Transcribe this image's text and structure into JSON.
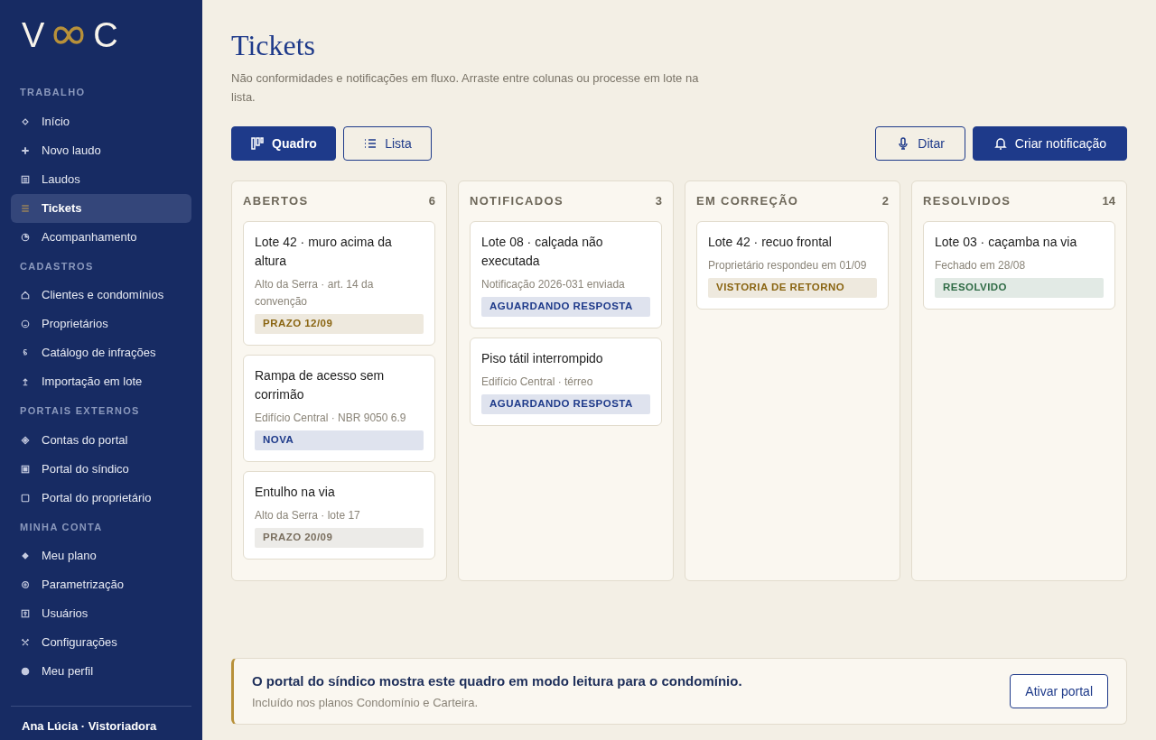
{
  "sidebar": {
    "logo": {
      "left": "V",
      "right": "C"
    },
    "sections": [
      {
        "title": "TRABALHO",
        "items": [
          {
            "label": "Início",
            "selected": false
          },
          {
            "label": "Novo laudo",
            "selected": false
          },
          {
            "label": "Laudos",
            "selected": false
          },
          {
            "label": "Tickets",
            "selected": true
          },
          {
            "label": "Acompanhamento",
            "selected": false
          }
        ]
      },
      {
        "title": "CADASTROS",
        "items": [
          {
            "label": "Clientes e condomínios",
            "selected": false
          },
          {
            "label": "Proprietários",
            "selected": false
          },
          {
            "label": "Catálogo de infrações",
            "selected": false
          },
          {
            "label": "Importação em lote",
            "selected": false
          }
        ]
      },
      {
        "title": "PORTAIS EXTERNOS",
        "items": [
          {
            "label": "Contas do portal",
            "selected": false
          },
          {
            "label": "Portal do síndico",
            "selected": false
          },
          {
            "label": "Portal do proprietário",
            "selected": false
          }
        ]
      },
      {
        "title": "MINHA CONTA",
        "items": [
          {
            "label": "Meu plano",
            "selected": false
          },
          {
            "label": "Parametrização",
            "selected": false
          },
          {
            "label": "Usuários",
            "selected": false
          },
          {
            "label": "Configurações",
            "selected": false
          },
          {
            "label": "Meu perfil",
            "selected": false
          }
        ]
      }
    ],
    "user": "Ana Lúcia · Vistoriadora"
  },
  "page": {
    "title": "Tickets",
    "subtitle": "Não conformidades e notificações em fluxo. Arraste entre colunas ou processe em lote na lista.",
    "views": [
      {
        "label": "Quadro",
        "selected": true
      },
      {
        "label": "Lista",
        "selected": false
      }
    ],
    "actions": [
      {
        "label": "Ditar",
        "kind": "secondary"
      },
      {
        "label": "Criar notificação",
        "kind": "primary"
      }
    ]
  },
  "board": [
    {
      "title": "ABERTOS",
      "count": "6",
      "cards": [
        {
          "title": "Lote 42 · muro acima da altura",
          "meta": "Alto da Serra · art. 14 da convenção",
          "tag": "PRAZO 12/09",
          "color": "#8a6512"
        },
        {
          "title": "Rampa de acesso sem corrimão",
          "meta": "Edifício Central · NBR 9050 6.9",
          "tag": "NOVA",
          "color": "#1e3a8a"
        },
        {
          "title": "Entulho na via",
          "meta": "Alto da Serra · lote 17",
          "tag": "PRAZO 20/09",
          "color": "#7a6f5f"
        }
      ]
    },
    {
      "title": "NOTIFICADOS",
      "count": "3",
      "cards": [
        {
          "title": "Lote 08 · calçada não executada",
          "meta": "Notificação 2026-031 enviada",
          "tag": "AGUARDANDO RESPOSTA",
          "color": "#1e3a8a"
        },
        {
          "title": "Piso tátil interrompido",
          "meta": "Edifício Central · térreo",
          "tag": "AGUARDANDO RESPOSTA",
          "color": "#1e3a8a"
        }
      ]
    },
    {
      "title": "EM CORREÇÃO",
      "count": "2",
      "cards": [
        {
          "title": "Lote 42 · recuo frontal",
          "meta": "Proprietário respondeu em 01/09",
          "tag": "VISTORIA DE RETORNO",
          "color": "#8a6512"
        }
      ]
    },
    {
      "title": "RESOLVIDOS",
      "count": "14",
      "cards": [
        {
          "title": "Lote 03 · caçamba na via",
          "meta": "Fechado em 28/08",
          "tag": "RESOLVIDO",
          "color": "#2f6b45"
        }
      ]
    }
  ],
  "banner": {
    "title": "O portal do síndico mostra este quadro em modo leitura para o condomínio.",
    "text": "Incluído nos planos Condomínio e Carteira.",
    "button": "Ativar portal"
  }
}
